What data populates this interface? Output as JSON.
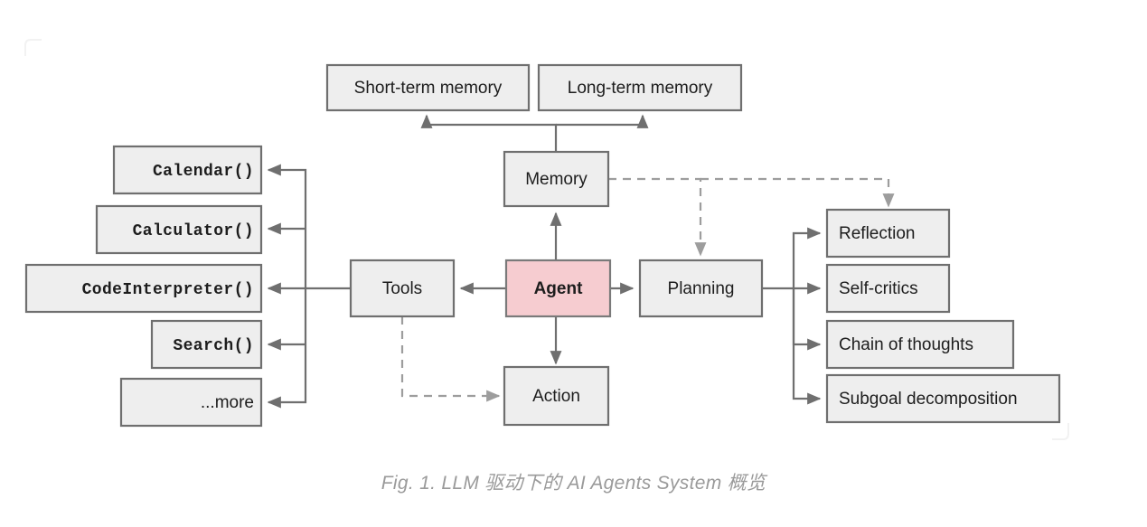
{
  "figure": {
    "caption": "Fig. 1. LLM 驱动下的 AI Agents System 概览",
    "background_color": "#ffffff",
    "node_fill": "#eeeeee",
    "node_stroke": "#6f6f6f",
    "accent_fill": "#f6ccd0",
    "dashed_stroke": "#9d9d9d",
    "caption_color": "#9a9a9a"
  },
  "diagram": {
    "type": "block-diagram",
    "center": {
      "agent": "Agent",
      "memory": "Memory",
      "tools": "Tools",
      "planning": "Planning",
      "action": "Action"
    },
    "memory_children": [
      {
        "label": "Short-term memory"
      },
      {
        "label": "Long-term memory"
      }
    ],
    "tools_children": [
      {
        "label": "Calendar()",
        "style": "mono"
      },
      {
        "label": "Calculator()",
        "style": "mono"
      },
      {
        "label": "CodeInterpreter()",
        "style": "mono"
      },
      {
        "label": "Search()",
        "style": "mono"
      },
      {
        "label": "...more",
        "style": "sans"
      }
    ],
    "planning_children": [
      {
        "label": "Reflection"
      },
      {
        "label": "Self-critics"
      },
      {
        "label": "Chain of thoughts"
      },
      {
        "label": "Subgoal decomposition"
      }
    ],
    "edges": [
      {
        "from": "Agent",
        "to": "Memory",
        "style": "solid"
      },
      {
        "from": "Agent",
        "to": "Tools",
        "style": "solid"
      },
      {
        "from": "Agent",
        "to": "Planning",
        "style": "solid"
      },
      {
        "from": "Agent",
        "to": "Action",
        "style": "solid"
      },
      {
        "from": "Memory",
        "to": "Short-term memory",
        "style": "solid"
      },
      {
        "from": "Memory",
        "to": "Long-term memory",
        "style": "solid"
      },
      {
        "from": "Memory",
        "to": "Planning",
        "style": "dashed"
      },
      {
        "from": "Memory",
        "to": "Reflection",
        "style": "dashed"
      },
      {
        "from": "Tools",
        "to": "Action",
        "style": "dashed"
      },
      {
        "from": "Tools",
        "to": "Calendar()",
        "style": "solid"
      },
      {
        "from": "Tools",
        "to": "Calculator()",
        "style": "solid"
      },
      {
        "from": "Tools",
        "to": "CodeInterpreter()",
        "style": "solid"
      },
      {
        "from": "Tools",
        "to": "Search()",
        "style": "solid"
      },
      {
        "from": "Tools",
        "to": "...more",
        "style": "solid"
      },
      {
        "from": "Planning",
        "to": "Reflection",
        "style": "solid"
      },
      {
        "from": "Planning",
        "to": "Self-critics",
        "style": "solid"
      },
      {
        "from": "Planning",
        "to": "Chain of thoughts",
        "style": "solid"
      },
      {
        "from": "Planning",
        "to": "Subgoal decomposition",
        "style": "solid"
      }
    ]
  }
}
